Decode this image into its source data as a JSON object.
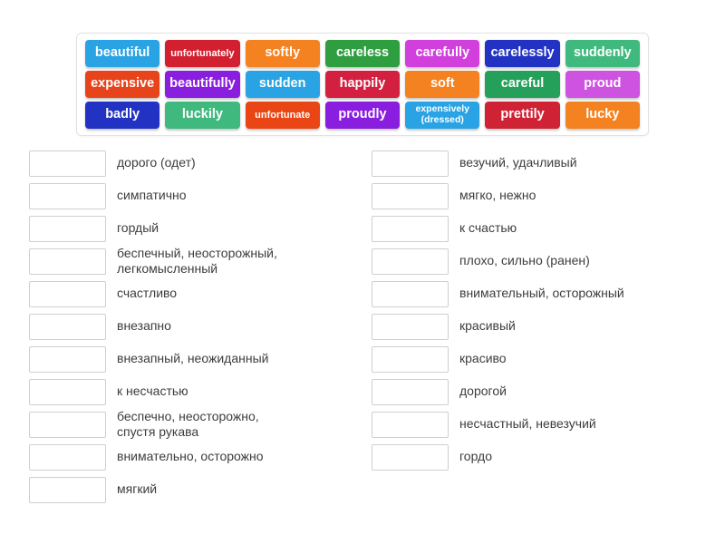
{
  "tile_bank": {
    "rows": [
      [
        {
          "label": "beautiful",
          "color": "#29a3e3",
          "size": "normal"
        },
        {
          "label": "unfortunately",
          "color": "#d32030",
          "size": "small"
        },
        {
          "label": "softly",
          "color": "#f58220",
          "size": "normal"
        },
        {
          "label": "careless",
          "color": "#2f9e41",
          "size": "normal"
        },
        {
          "label": "carefully",
          "color": "#d13fdc",
          "size": "normal"
        },
        {
          "label": "carelessly",
          "color": "#2233c4",
          "size": "normal"
        },
        {
          "label": "suddenly",
          "color": "#40b97f",
          "size": "normal"
        }
      ],
      [
        {
          "label": "expensive",
          "color": "#e8441c",
          "size": "normal"
        },
        {
          "label": "beautifully",
          "color": "#8a1ede",
          "size": "normal"
        },
        {
          "label": "sudden",
          "color": "#29a3e3",
          "size": "normal"
        },
        {
          "label": "happily",
          "color": "#d32040",
          "size": "normal"
        },
        {
          "label": "soft",
          "color": "#f58220",
          "size": "normal"
        },
        {
          "label": "careful",
          "color": "#25a05a",
          "size": "normal"
        },
        {
          "label": "proud",
          "color": "#cd53e0",
          "size": "normal"
        }
      ],
      [
        {
          "label": "badly",
          "color": "#2233c4",
          "size": "normal"
        },
        {
          "label": "luckily",
          "color": "#40b97f",
          "size": "normal"
        },
        {
          "label": "unfortunate",
          "color": "#ea4514",
          "size": "small"
        },
        {
          "label": "proudly",
          "color": "#8a1ede",
          "size": "normal"
        },
        {
          "label": "expensively\n(dressed)",
          "color": "#29a3e3",
          "size": "tiny"
        },
        {
          "label": "prettily",
          "color": "#cf2335",
          "size": "normal"
        },
        {
          "label": "lucky",
          "color": "#f58220",
          "size": "normal"
        }
      ]
    ]
  },
  "answers": {
    "left_column": [
      {
        "definition": "дорого (одет)"
      },
      {
        "definition": "симпатично"
      },
      {
        "definition": "гордый"
      },
      {
        "definition": "беспечный, неосторожный,\nлегкомысленный"
      },
      {
        "definition": "счастливо"
      },
      {
        "definition": "внезапно"
      },
      {
        "definition": "внезапный, неожиданный"
      },
      {
        "definition": "к несчастью"
      },
      {
        "definition": "беспечно, неосторожно,\nспустя рукава"
      },
      {
        "definition": "внимательно, осторожно"
      },
      {
        "definition": "мягкий"
      }
    ],
    "right_column": [
      {
        "definition": "везучий, удачливый"
      },
      {
        "definition": "мягко, нежно"
      },
      {
        "definition": "к счастью"
      },
      {
        "definition": "плохо, сильно (ранен)"
      },
      {
        "definition": "внимательный, осторожный"
      },
      {
        "definition": "красивый"
      },
      {
        "definition": "красиво"
      },
      {
        "definition": "дорогой"
      },
      {
        "definition": "несчастный, невезучий"
      },
      {
        "definition": "гордо"
      }
    ]
  }
}
